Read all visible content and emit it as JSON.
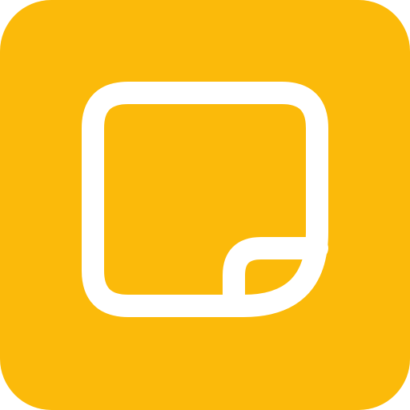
{
  "app_icon": {
    "icon_name": "sticky-note-icon",
    "colors": {
      "background": "#FBBA0A",
      "glyph": "#FFFFFF"
    }
  }
}
